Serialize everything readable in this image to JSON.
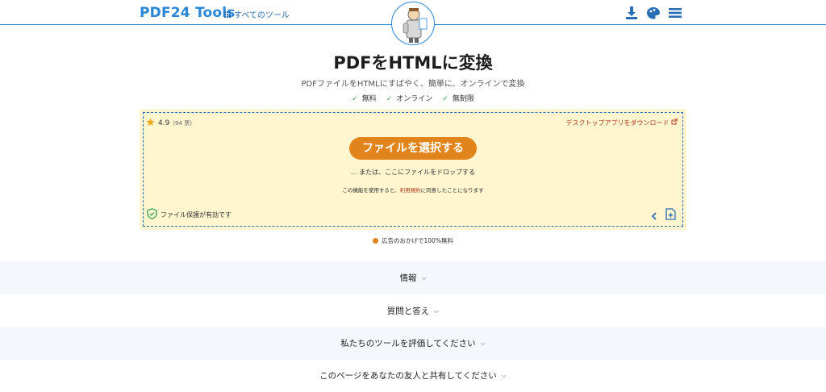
{
  "header": {
    "brand": "PDF24 Tools",
    "all_tools": "すべてのツール",
    "icons": [
      "download-icon",
      "theme-icon",
      "menu-icon"
    ]
  },
  "page": {
    "title": "PDFをHTMLに変換",
    "subtitle": "PDFファイルをHTMLにすばやく、簡単に、オンラインで変換",
    "features": [
      "無料",
      "オンライン",
      "無制限"
    ]
  },
  "upload": {
    "rating_value": "4.9",
    "rating_votes": "(94 票)",
    "desktop_link": "デスクトップアプリをダウンロード",
    "choose_button": "ファイルを選択する",
    "drop_text": "... または、ここにファイルをドロップする",
    "terms_before": "この機能を使用すると、",
    "terms_link": "利用規約",
    "terms_after": "に同意したことになります",
    "protection": "ファイル保護が有効です"
  },
  "ad_note": "広告のおかげで100%無料",
  "sections": [
    {
      "label": "情報"
    },
    {
      "label": "質問と答え"
    },
    {
      "label": "私たちのツールを評価してください"
    },
    {
      "label": "このページをあなたの友人と共有してください"
    }
  ],
  "colors": {
    "brand_blue": "#2a86d6",
    "accent_orange": "#e0841b",
    "upload_bg": "#fff6cf",
    "link_red": "#b3371d",
    "check_green": "#3aa05a"
  }
}
